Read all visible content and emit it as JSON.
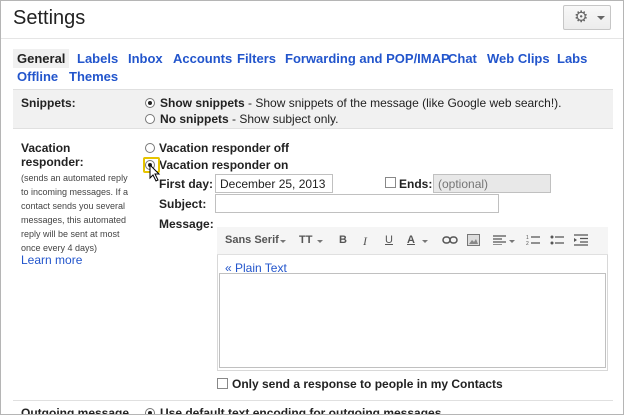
{
  "header": {
    "title": "Settings",
    "gear_icon": "gear-icon"
  },
  "tabs": [
    {
      "label": "General"
    },
    {
      "label": "Labels"
    },
    {
      "label": "Inbox"
    },
    {
      "label": "Accounts"
    },
    {
      "label": "Filters"
    },
    {
      "label": "Forwarding and POP/IMAP"
    },
    {
      "label": "Chat"
    },
    {
      "label": "Web Clips"
    },
    {
      "label": "Labs"
    },
    {
      "label": "Offline"
    },
    {
      "label": "Themes"
    }
  ],
  "snippets": {
    "label": "Snippets:",
    "option1_bold": "Show snippets",
    "option1_rest": " - Show snippets of the message (like Google web search!).",
    "option2_bold": "No snippets",
    "option2_rest": " - Show subject only."
  },
  "vacation": {
    "label_line1": "Vacation",
    "label_line2": "responder:",
    "help_lines": [
      "(sends an automated reply",
      "to incoming messages. If a",
      "contact sends you several",
      "messages, this automated",
      "reply will be sent at most",
      "once every 4 days)"
    ],
    "learn_more": "Learn more",
    "off_label": "Vacation responder off",
    "on_label": "Vacation responder on",
    "first_day_label": "First day:",
    "first_day_value": "December 25, 2013",
    "ends_label": "Ends:",
    "ends_placeholder": "(optional)",
    "subject_label": "Subject:",
    "message_label": "Message:",
    "plain_text_link": "« Plain Text",
    "only_contacts_label": "Only send a response to people in my Contacts"
  },
  "toolbar": {
    "font": "Sans Serif",
    "size_icon": "TT",
    "bold": "B",
    "italic": "I",
    "underline": "U",
    "text_color": "A"
  },
  "outgoing": {
    "label": "Outgoing message",
    "option_text": "Use default text encoding for outgoing messages"
  }
}
